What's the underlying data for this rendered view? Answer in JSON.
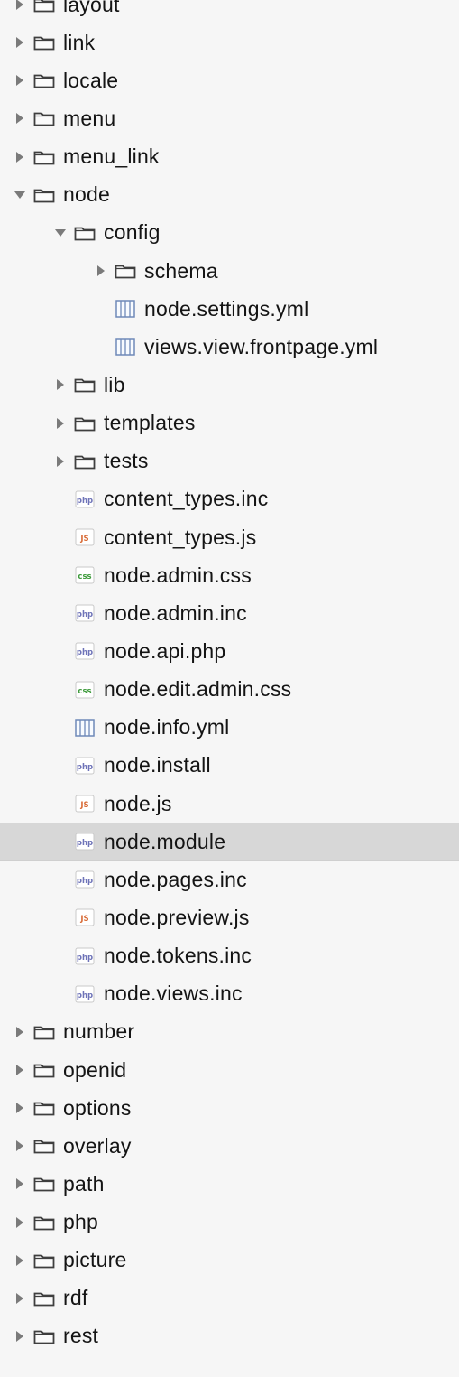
{
  "tree": [
    {
      "label": "layout",
      "type": "folder",
      "level": 0,
      "state": "collapsed"
    },
    {
      "label": "link",
      "type": "folder",
      "level": 0,
      "state": "collapsed"
    },
    {
      "label": "locale",
      "type": "folder",
      "level": 0,
      "state": "collapsed"
    },
    {
      "label": "menu",
      "type": "folder",
      "level": 0,
      "state": "collapsed"
    },
    {
      "label": "menu_link",
      "type": "folder",
      "level": 0,
      "state": "collapsed"
    },
    {
      "label": "node",
      "type": "folder",
      "level": 0,
      "state": "expanded"
    },
    {
      "label": "config",
      "type": "folder",
      "level": 1,
      "state": "expanded"
    },
    {
      "label": "schema",
      "type": "folder",
      "level": 2,
      "state": "collapsed"
    },
    {
      "label": "node.settings.yml",
      "type": "yml",
      "level": 2
    },
    {
      "label": "views.view.frontpage.yml",
      "type": "yml",
      "level": 2
    },
    {
      "label": "lib",
      "type": "folder",
      "level": 1,
      "state": "collapsed"
    },
    {
      "label": "templates",
      "type": "folder",
      "level": 1,
      "state": "collapsed"
    },
    {
      "label": "tests",
      "type": "folder",
      "level": 1,
      "state": "collapsed"
    },
    {
      "label": "content_types.inc",
      "type": "php",
      "level": 1
    },
    {
      "label": "content_types.js",
      "type": "js",
      "level": 1
    },
    {
      "label": "node.admin.css",
      "type": "css",
      "level": 1
    },
    {
      "label": "node.admin.inc",
      "type": "php",
      "level": 1
    },
    {
      "label": "node.api.php",
      "type": "php",
      "level": 1
    },
    {
      "label": "node.edit.admin.css",
      "type": "css",
      "level": 1
    },
    {
      "label": "node.info.yml",
      "type": "yml",
      "level": 1
    },
    {
      "label": "node.install",
      "type": "php",
      "level": 1
    },
    {
      "label": "node.js",
      "type": "js",
      "level": 1
    },
    {
      "label": "node.module",
      "type": "php",
      "level": 1,
      "selected": true
    },
    {
      "label": "node.pages.inc",
      "type": "php",
      "level": 1
    },
    {
      "label": "node.preview.js",
      "type": "js",
      "level": 1
    },
    {
      "label": "node.tokens.inc",
      "type": "php",
      "level": 1
    },
    {
      "label": "node.views.inc",
      "type": "php",
      "level": 1
    },
    {
      "label": "number",
      "type": "folder",
      "level": 0,
      "state": "collapsed"
    },
    {
      "label": "openid",
      "type": "folder",
      "level": 0,
      "state": "collapsed"
    },
    {
      "label": "options",
      "type": "folder",
      "level": 0,
      "state": "collapsed"
    },
    {
      "label": "overlay",
      "type": "folder",
      "level": 0,
      "state": "collapsed"
    },
    {
      "label": "path",
      "type": "folder",
      "level": 0,
      "state": "collapsed"
    },
    {
      "label": "php",
      "type": "folder",
      "level": 0,
      "state": "collapsed"
    },
    {
      "label": "picture",
      "type": "folder",
      "level": 0,
      "state": "collapsed"
    },
    {
      "label": "rdf",
      "type": "folder",
      "level": 0,
      "state": "collapsed"
    },
    {
      "label": "rest",
      "type": "folder",
      "level": 0,
      "state": "collapsed"
    }
  ],
  "icons": {
    "folder": "folder-icon",
    "yml": "yml-file-icon",
    "php": "php-file-icon",
    "js": "js-file-icon",
    "css": "css-file-icon",
    "collapsed": "triangle-right-icon",
    "expanded": "triangle-down-icon"
  },
  "colors": {
    "background": "#f6f6f6",
    "selected_row": "#d7d7d7",
    "disclosure": "#7a7a7a",
    "folder_stroke": "#3f3f3f",
    "php_badge": "#6e73b8",
    "js_badge": "#d96b36",
    "css_badge": "#3e9b3c",
    "yml_stroke": "#6f89b8"
  }
}
